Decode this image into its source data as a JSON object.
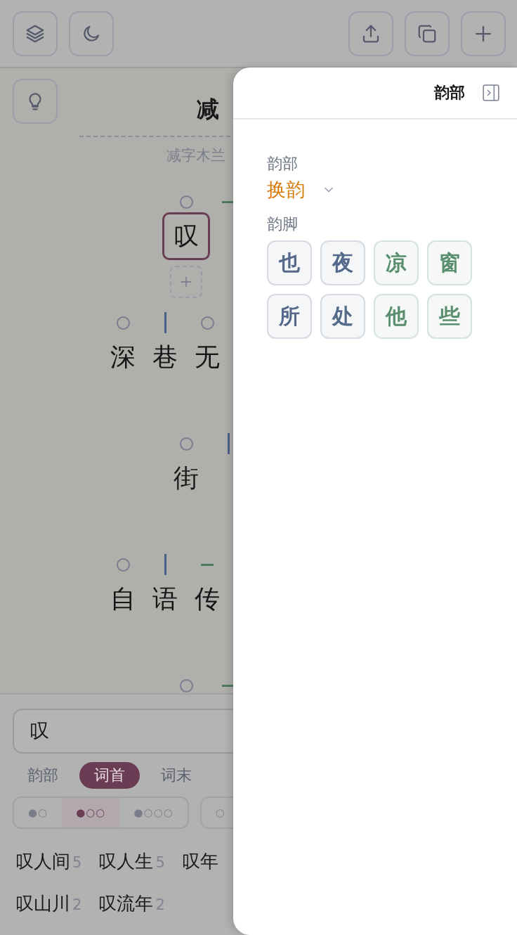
{
  "top_bar": {
    "left_buttons": [
      {
        "kind": "layers"
      },
      {
        "kind": "moon"
      }
    ],
    "right_buttons": [
      {
        "kind": "share"
      },
      {
        "kind": "copy"
      },
      {
        "kind": "add"
      }
    ]
  },
  "poem": {
    "title": "减",
    "subtitle": "减字木兰",
    "rows": [
      {
        "marks": [
          {
            "kind": "circle"
          },
          {
            "kind": "dash"
          }
        ],
        "chars": [
          {
            "text": "叹",
            "selected": true
          }
        ],
        "add_button": true
      },
      {
        "marks": [
          {
            "kind": "circle"
          },
          {
            "kind": "bar"
          },
          {
            "kind": "circle"
          }
        ],
        "chars": [
          {
            "text": "深",
            "selected": false
          },
          {
            "text": "巷",
            "selected": false
          },
          {
            "text": "无",
            "selected": false
          }
        ]
      },
      {
        "marks": [
          {
            "kind": "circle"
          },
          {
            "kind": "bar"
          }
        ],
        "chars": [
          {
            "text": "街",
            "selected": false
          }
        ]
      },
      {
        "marks": [
          {
            "kind": "circle"
          },
          {
            "kind": "bar"
          },
          {
            "kind": "dash"
          }
        ],
        "chars": [
          {
            "text": "自",
            "selected": false
          },
          {
            "text": "语",
            "selected": false
          },
          {
            "text": "传",
            "selected": false
          }
        ]
      },
      {
        "marks": [
          {
            "kind": "circle"
          },
          {
            "kind": "dash"
          }
        ]
      }
    ]
  },
  "search": {
    "value": "叹"
  },
  "tabs": [
    {
      "label": "韵部",
      "selected": false
    },
    {
      "label": "词首",
      "selected": true
    },
    {
      "label": "词末",
      "selected": false
    }
  ],
  "length_segments": [
    {
      "label": "●○",
      "selected": false
    },
    {
      "label": "●○○",
      "selected": true
    },
    {
      "label": "●○○○",
      "selected": false
    }
  ],
  "second_segments": [
    {
      "label": "○",
      "selected": false
    }
  ],
  "results": [
    [
      {
        "word": "叹人间",
        "count": "5"
      },
      {
        "word": "叹人生",
        "count": "5"
      },
      {
        "word": "叹年"
      }
    ],
    [
      {
        "word": "叹山川",
        "count": "2"
      },
      {
        "word": "叹流年",
        "count": "2"
      }
    ]
  ],
  "drawer": {
    "title": "韵部",
    "rhyme_label": "韵部",
    "rhyme_value": "换韵",
    "feet_label": "韵脚",
    "feet": [
      {
        "text": "也",
        "color": "#55698a"
      },
      {
        "text": "夜",
        "color": "#55698a"
      },
      {
        "text": "凉",
        "color": "#5a8f6e"
      },
      {
        "text": "窗",
        "color": "#5a8f6e"
      },
      {
        "text": "所",
        "color": "#55698a"
      },
      {
        "text": "处",
        "color": "#55698a"
      },
      {
        "text": "他",
        "color": "#5a8f6e"
      },
      {
        "text": "些",
        "color": "#5a8f6e"
      }
    ]
  }
}
